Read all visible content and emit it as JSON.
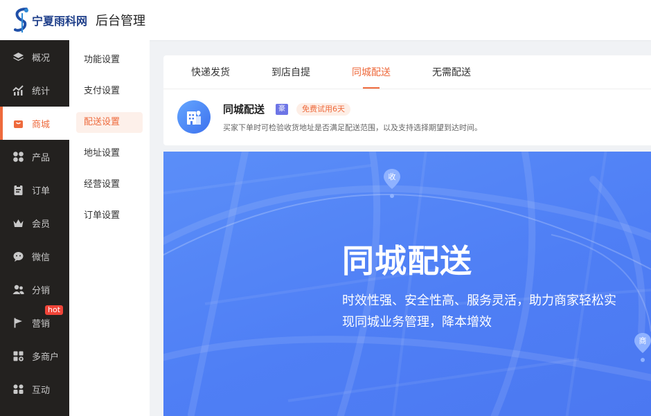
{
  "brand": {
    "logo_text": "宁夏雨科网",
    "title": "后台管理"
  },
  "sidebar": {
    "items": [
      {
        "label": "概况",
        "icon": "layers-icon"
      },
      {
        "label": "统计",
        "icon": "chart-icon"
      },
      {
        "label": "商城",
        "icon": "shop-icon",
        "active": true
      },
      {
        "label": "产品",
        "icon": "grid-icon"
      },
      {
        "label": "订单",
        "icon": "clipboard-icon"
      },
      {
        "label": "会员",
        "icon": "crown-icon"
      },
      {
        "label": "微信",
        "icon": "wechat-icon"
      },
      {
        "label": "分销",
        "icon": "users-icon"
      },
      {
        "label": "营销",
        "icon": "flag-icon",
        "badge": "hot"
      },
      {
        "label": "多商户",
        "icon": "store-plus-icon"
      },
      {
        "label": "互动",
        "icon": "interact-icon"
      }
    ]
  },
  "submenu": {
    "items": [
      {
        "label": "功能设置"
      },
      {
        "label": "支付设置"
      },
      {
        "label": "配送设置",
        "active": true
      },
      {
        "label": "地址设置"
      },
      {
        "label": "经营设置"
      },
      {
        "label": "订单设置"
      }
    ]
  },
  "tabs": [
    {
      "label": "快递发货"
    },
    {
      "label": "到店自提"
    },
    {
      "label": "同城配送",
      "active": true
    },
    {
      "label": "无需配送"
    }
  ],
  "feature": {
    "title": "同城配送",
    "pro_badge": "豪",
    "trial_badge": "免费试用6天",
    "description": "买家下单时可检验收货地址是否满足配送范围，以及支持选择期望到达时间。"
  },
  "banner": {
    "title": "同城配送",
    "subtitle": "时效性强、安全性高、服务灵活，助力商家轻松实现同城业务管理，降本增效",
    "pin_receive": "收",
    "pin_shop": "商"
  },
  "colors": {
    "accent": "#ee6a3c",
    "sidebar_bg": "#23211f",
    "banner_blue": "#4f7ff5"
  }
}
